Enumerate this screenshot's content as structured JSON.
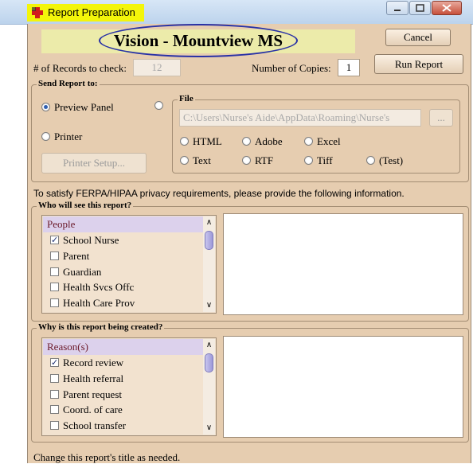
{
  "window": {
    "title": "Report Preparation",
    "highlight_color": "#f3f50a"
  },
  "header": {
    "report_title": "Vision - Mountview MS",
    "cancel_label": "Cancel",
    "run_label": "Run Report"
  },
  "records": {
    "label": "# of Records to check:",
    "value": "12"
  },
  "copies": {
    "label": "Number of Copies:",
    "value": "1"
  },
  "send_to": {
    "legend": "Send Report to:",
    "preview_label": "Preview Panel",
    "printer_label": "Printer",
    "printer_setup_label": "Printer Setup...",
    "selected": "Preview Panel"
  },
  "file": {
    "legend": "File",
    "path": "C:\\Users\\Nurse's Aide\\AppData\\Roaming\\Nurse's",
    "browse_label": "...",
    "formats": [
      "HTML",
      "Adobe",
      "Excel",
      "Text",
      "RTF",
      "Tiff",
      "(Test)"
    ]
  },
  "ferpa_notice": "To satisfy FERPA/HIPAA privacy requirements, please provide the following information.",
  "who": {
    "legend": "Who will see this report?",
    "header": "People",
    "items": [
      {
        "label": "School Nurse",
        "checked": true
      },
      {
        "label": "Parent",
        "checked": false
      },
      {
        "label": "Guardian",
        "checked": false
      },
      {
        "label": "Health Svcs Offc",
        "checked": false
      },
      {
        "label": "Health Care Prov",
        "checked": false
      }
    ]
  },
  "why": {
    "legend": "Why is this report being created?",
    "header": "Reason(s)",
    "items": [
      {
        "label": "Record review",
        "checked": true
      },
      {
        "label": "Health referral",
        "checked": false
      },
      {
        "label": "Parent request",
        "checked": false
      },
      {
        "label": "Coord. of care",
        "checked": false
      },
      {
        "label": "School transfer",
        "checked": false
      }
    ]
  },
  "status": "Change this report's title as needed.",
  "icons": {
    "app": "medical-cross-icon",
    "check": "✓",
    "scroll_up": "∧",
    "scroll_down": "∨"
  }
}
